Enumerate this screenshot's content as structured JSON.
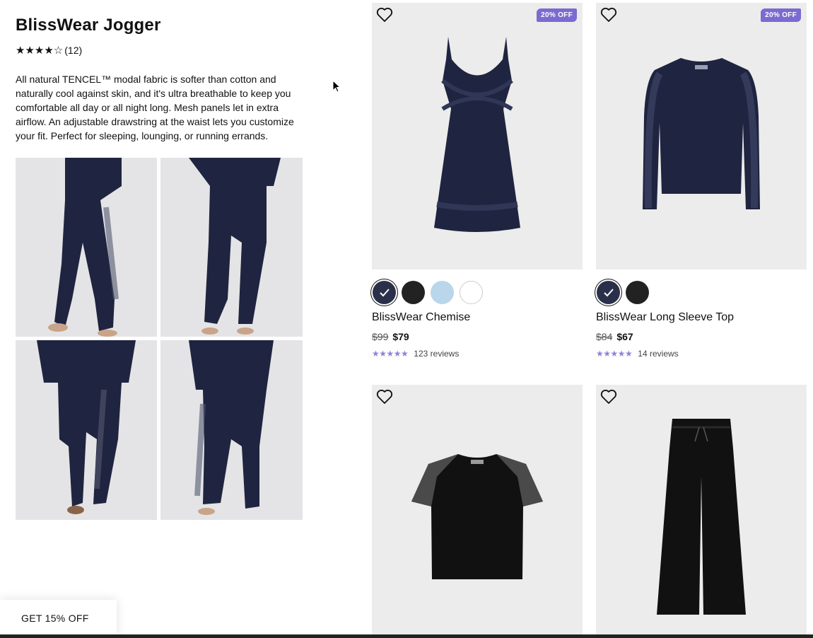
{
  "product": {
    "title": "BlissWear Jogger",
    "stars": "★★★★☆",
    "rating_count": "(12)",
    "description": "All natural TENCEL™ modal fabric is softer than cotton and naturally cool against skin, and it's ultra breathable to keep you comfortable all day or all night long. Mesh panels let in extra airflow. An adjustable drawstring at the waist lets you customize your fit. Perfect for sleeping, lounging, or running errands.",
    "rating": 4.5
  },
  "promo": {
    "label": "GET 15% OFF"
  },
  "cards": [
    {
      "name": "BlissWear Chemise",
      "badge": "20% OFF",
      "old_price": "$99",
      "price": "$79",
      "stars": "★★★★★",
      "reviews": "123 reviews",
      "swatches": [
        "#2a2f4a",
        "#222222",
        "#b9d6ea",
        "#ffffff"
      ],
      "selected_swatch": 0
    },
    {
      "name": "BlissWear Long Sleeve Top",
      "badge": "20% OFF",
      "old_price": "$84",
      "price": "$67",
      "stars": "★★★★★",
      "reviews": "14 reviews",
      "swatches": [
        "#2a2f4a",
        "#222222"
      ],
      "selected_swatch": 0
    },
    {
      "name": "",
      "badge": ""
    },
    {
      "name": "",
      "badge": ""
    }
  ],
  "colors": {
    "accent": "#7a6bd1",
    "navy": "#1f2440",
    "image_bg": "#ececec"
  }
}
